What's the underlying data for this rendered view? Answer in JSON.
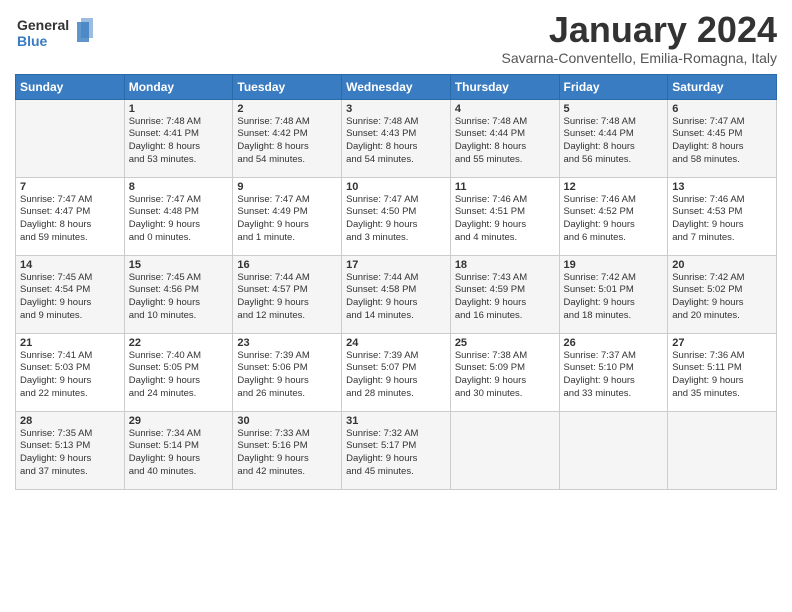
{
  "logo": {
    "line1": "General",
    "line2": "Blue"
  },
  "title": "January 2024",
  "subtitle": "Savarna-Conventello, Emilia-Romagna, Italy",
  "days_of_week": [
    "Sunday",
    "Monday",
    "Tuesday",
    "Wednesday",
    "Thursday",
    "Friday",
    "Saturday"
  ],
  "weeks": [
    [
      {
        "num": "",
        "info": ""
      },
      {
        "num": "1",
        "info": "Sunrise: 7:48 AM\nSunset: 4:41 PM\nDaylight: 8 hours\nand 53 minutes."
      },
      {
        "num": "2",
        "info": "Sunrise: 7:48 AM\nSunset: 4:42 PM\nDaylight: 8 hours\nand 54 minutes."
      },
      {
        "num": "3",
        "info": "Sunrise: 7:48 AM\nSunset: 4:43 PM\nDaylight: 8 hours\nand 54 minutes."
      },
      {
        "num": "4",
        "info": "Sunrise: 7:48 AM\nSunset: 4:44 PM\nDaylight: 8 hours\nand 55 minutes."
      },
      {
        "num": "5",
        "info": "Sunrise: 7:48 AM\nSunset: 4:44 PM\nDaylight: 8 hours\nand 56 minutes."
      },
      {
        "num": "6",
        "info": "Sunrise: 7:47 AM\nSunset: 4:45 PM\nDaylight: 8 hours\nand 58 minutes."
      }
    ],
    [
      {
        "num": "7",
        "info": "Sunrise: 7:47 AM\nSunset: 4:47 PM\nDaylight: 8 hours\nand 59 minutes."
      },
      {
        "num": "8",
        "info": "Sunrise: 7:47 AM\nSunset: 4:48 PM\nDaylight: 9 hours\nand 0 minutes."
      },
      {
        "num": "9",
        "info": "Sunrise: 7:47 AM\nSunset: 4:49 PM\nDaylight: 9 hours\nand 1 minute."
      },
      {
        "num": "10",
        "info": "Sunrise: 7:47 AM\nSunset: 4:50 PM\nDaylight: 9 hours\nand 3 minutes."
      },
      {
        "num": "11",
        "info": "Sunrise: 7:46 AM\nSunset: 4:51 PM\nDaylight: 9 hours\nand 4 minutes."
      },
      {
        "num": "12",
        "info": "Sunrise: 7:46 AM\nSunset: 4:52 PM\nDaylight: 9 hours\nand 6 minutes."
      },
      {
        "num": "13",
        "info": "Sunrise: 7:46 AM\nSunset: 4:53 PM\nDaylight: 9 hours\nand 7 minutes."
      }
    ],
    [
      {
        "num": "14",
        "info": "Sunrise: 7:45 AM\nSunset: 4:54 PM\nDaylight: 9 hours\nand 9 minutes."
      },
      {
        "num": "15",
        "info": "Sunrise: 7:45 AM\nSunset: 4:56 PM\nDaylight: 9 hours\nand 10 minutes."
      },
      {
        "num": "16",
        "info": "Sunrise: 7:44 AM\nSunset: 4:57 PM\nDaylight: 9 hours\nand 12 minutes."
      },
      {
        "num": "17",
        "info": "Sunrise: 7:44 AM\nSunset: 4:58 PM\nDaylight: 9 hours\nand 14 minutes."
      },
      {
        "num": "18",
        "info": "Sunrise: 7:43 AM\nSunset: 4:59 PM\nDaylight: 9 hours\nand 16 minutes."
      },
      {
        "num": "19",
        "info": "Sunrise: 7:42 AM\nSunset: 5:01 PM\nDaylight: 9 hours\nand 18 minutes."
      },
      {
        "num": "20",
        "info": "Sunrise: 7:42 AM\nSunset: 5:02 PM\nDaylight: 9 hours\nand 20 minutes."
      }
    ],
    [
      {
        "num": "21",
        "info": "Sunrise: 7:41 AM\nSunset: 5:03 PM\nDaylight: 9 hours\nand 22 minutes."
      },
      {
        "num": "22",
        "info": "Sunrise: 7:40 AM\nSunset: 5:05 PM\nDaylight: 9 hours\nand 24 minutes."
      },
      {
        "num": "23",
        "info": "Sunrise: 7:39 AM\nSunset: 5:06 PM\nDaylight: 9 hours\nand 26 minutes."
      },
      {
        "num": "24",
        "info": "Sunrise: 7:39 AM\nSunset: 5:07 PM\nDaylight: 9 hours\nand 28 minutes."
      },
      {
        "num": "25",
        "info": "Sunrise: 7:38 AM\nSunset: 5:09 PM\nDaylight: 9 hours\nand 30 minutes."
      },
      {
        "num": "26",
        "info": "Sunrise: 7:37 AM\nSunset: 5:10 PM\nDaylight: 9 hours\nand 33 minutes."
      },
      {
        "num": "27",
        "info": "Sunrise: 7:36 AM\nSunset: 5:11 PM\nDaylight: 9 hours\nand 35 minutes."
      }
    ],
    [
      {
        "num": "28",
        "info": "Sunrise: 7:35 AM\nSunset: 5:13 PM\nDaylight: 9 hours\nand 37 minutes."
      },
      {
        "num": "29",
        "info": "Sunrise: 7:34 AM\nSunset: 5:14 PM\nDaylight: 9 hours\nand 40 minutes."
      },
      {
        "num": "30",
        "info": "Sunrise: 7:33 AM\nSunset: 5:16 PM\nDaylight: 9 hours\nand 42 minutes."
      },
      {
        "num": "31",
        "info": "Sunrise: 7:32 AM\nSunset: 5:17 PM\nDaylight: 9 hours\nand 45 minutes."
      },
      {
        "num": "",
        "info": ""
      },
      {
        "num": "",
        "info": ""
      },
      {
        "num": "",
        "info": ""
      }
    ]
  ]
}
